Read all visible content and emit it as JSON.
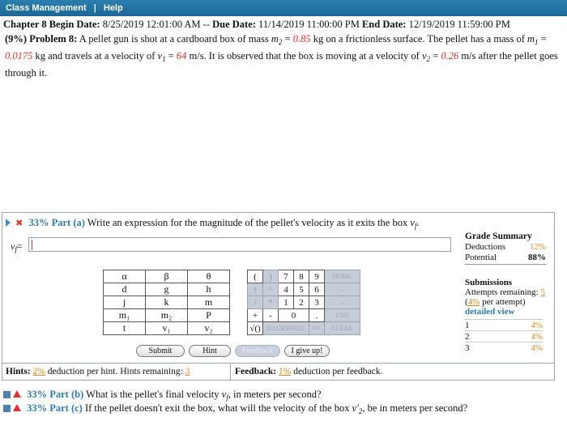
{
  "topbar": {
    "class_management": "Class Management",
    "separator": "|",
    "help": "Help"
  },
  "chapter": {
    "title": "Chapter 8",
    "begin_label": "Begin Date:",
    "begin_date": "8/25/2019 12:01:00 AM",
    "dash": "--",
    "due_label": "Due Date:",
    "due_date": "11/14/2019 11:00:00 PM",
    "end_label": "End Date:",
    "end_date": "12/19/2019 11:59:00 PM"
  },
  "problem": {
    "weight": "(9%)",
    "label": "Problem 8:",
    "t1": "A pellet gun is shot at a cardboard box of mass",
    "m2_sym": "m",
    "m2_sub": "2",
    "eq": "=",
    "m2_val": "0.85",
    "t2": "kg on a frictionless surface. The pellet has a mass of",
    "m1_sym": "m",
    "m1_sub": "1",
    "m1_val": "0.0175",
    "t3": "kg and travels at a velocity of",
    "v1_sym": "v",
    "v1_sub": "1",
    "v1_val": "64",
    "t4": "m/s. It is observed that the box is moving at a velocity of",
    "v2_sym": "v",
    "v2_sub": "2",
    "v2_val": "0.26",
    "t5": "m/s after the pellet goes through it."
  },
  "part_a": {
    "pct": "33% Part (a)",
    "text": "Write an expression for the magnitude of the pellet's velocity as it exits the box",
    "var": "v",
    "var_sub": "f",
    "answer_label": "v",
    "answer_sub": "f",
    "answer_eq": "=",
    "answer_value": ""
  },
  "keypad": {
    "rows": [
      [
        "α",
        "β",
        "θ"
      ],
      [
        "d",
        "g",
        "h"
      ],
      [
        "j",
        "k",
        "m"
      ],
      [
        "m₁",
        "m₂",
        "P"
      ],
      [
        "t",
        "v₁",
        "v₂"
      ]
    ]
  },
  "numpad": {
    "r1": [
      "(",
      ")",
      "7",
      "8",
      "9",
      "HOME"
    ],
    "r2": [
      "↑",
      "^",
      "4",
      "5",
      "6",
      "←"
    ],
    "r3": [
      "/",
      "*",
      "1",
      "2",
      "3",
      "→"
    ],
    "r4": [
      "+",
      "-",
      "0",
      ".",
      "END"
    ],
    "r5": [
      "√()",
      "BACKSPACE",
      "DEL",
      "CLEAR"
    ]
  },
  "buttons": {
    "submit": "Submit",
    "hint": "Hint",
    "feedback": "Feedback",
    "give_up": "I give up!"
  },
  "hints": {
    "label": "Hints:",
    "pct": "2%",
    "text": "deduction per hint. Hints remaining:",
    "remaining": "3"
  },
  "feedback": {
    "label": "Feedback:",
    "pct": "1%",
    "text": "deduction per feedback."
  },
  "grade_summary": {
    "title": "Grade Summary",
    "deductions_label": "Deductions",
    "deductions_value": "12%",
    "potential_label": "Potential",
    "potential_value": "88%"
  },
  "submissions": {
    "title": "Submissions",
    "attempts_label": "Attempts remaining:",
    "attempts_value": "5",
    "per_attempt_pct": "4%",
    "per_attempt_text": "per attempt)",
    "detailed_view": "detailed view",
    "rows": [
      [
        "1",
        "4%"
      ],
      [
        "2",
        "4%"
      ],
      [
        "3",
        "4%"
      ]
    ]
  },
  "part_b": {
    "pct": "33% Part (b)",
    "text": "What is the pellet's final velocity",
    "var": "v",
    "var_sub": "f",
    "text2": ", in meters per second?"
  },
  "part_c": {
    "pct": "33% Part (c)",
    "text": "If the pellet doesn't exit the box, what will the velocity of the box",
    "var": "v'",
    "var_sub": "2",
    "text2": ", be in meters per second?"
  }
}
